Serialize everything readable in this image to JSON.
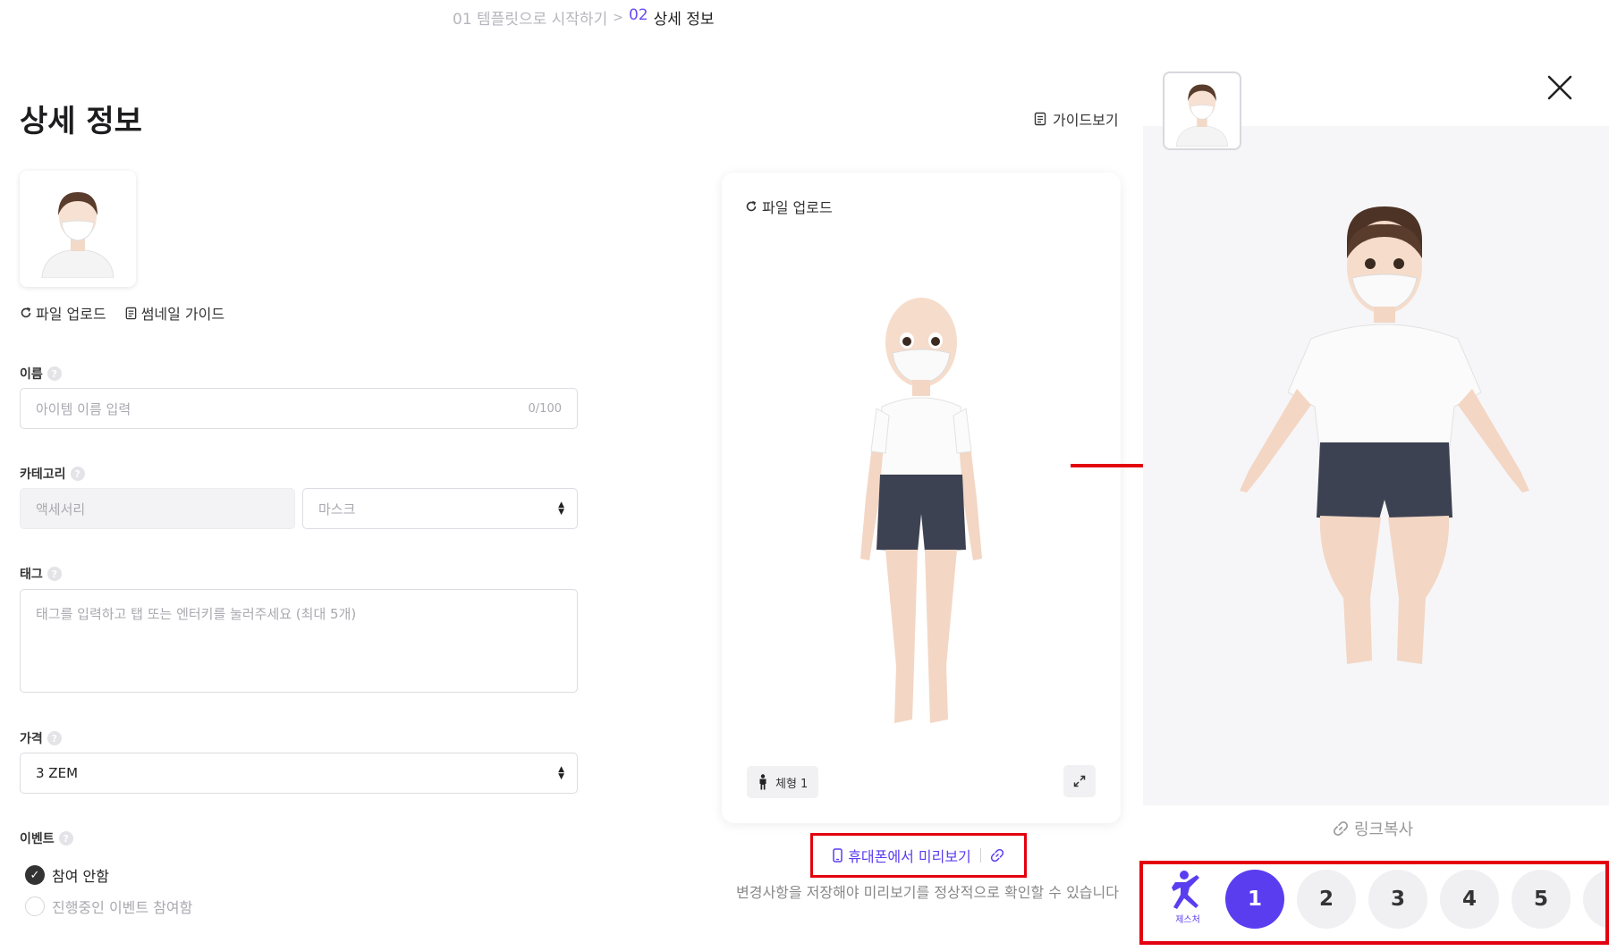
{
  "breadcrumb": {
    "step1_num": "01",
    "step1_label": "템플릿으로 시작하기",
    "separator": ">",
    "step2_num": "02",
    "step2_label": "상세 정보"
  },
  "page_title": "상세 정보",
  "guide_label": "가이드보기",
  "thumbnail": {
    "upload_label": "파일 업로드",
    "guide_label": "썸네일 가이드"
  },
  "form": {
    "name": {
      "label": "이름",
      "placeholder": "아이템 이름 입력",
      "counter": "0/100"
    },
    "category": {
      "label": "카테고리",
      "primary": "액세서리",
      "secondary": "마스크"
    },
    "tags": {
      "label": "태그",
      "placeholder": "태그를 입력하고 탭 또는 엔터키를 눌러주세요 (최대 5개)"
    },
    "price": {
      "label": "가격",
      "value": "3 ZEM"
    },
    "event": {
      "label": "이벤트",
      "options": [
        {
          "label": "참여 안함",
          "selected": true
        },
        {
          "label": "진행중인 이벤트 참여함",
          "selected": false
        }
      ]
    },
    "help_glyph": "?"
  },
  "preview": {
    "upload_label": "파일 업로드",
    "body_type_label": "체형 1",
    "phone_preview_label": "휴대폰에서 미리보기",
    "note": "변경사항을 저장해야 미리보기를 정상적으로 확인할 수 있습니다"
  },
  "right_panel": {
    "link_copy_label": "링크복사",
    "gesture_label": "제스처",
    "poses": [
      "1",
      "2",
      "3",
      "4",
      "5"
    ],
    "active_pose": "1"
  },
  "colors": {
    "accent": "#5b3df0",
    "highlight_border": "#e3000f",
    "arrow": "#e3000f"
  },
  "icons": [
    "refresh-icon",
    "document-icon",
    "help-icon",
    "check-icon",
    "person-icon",
    "expand-icon",
    "phone-icon",
    "link-icon",
    "close-icon",
    "gesture-icon",
    "arrow-right-icon"
  ]
}
